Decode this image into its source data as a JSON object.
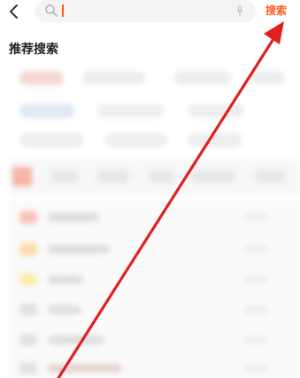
{
  "header": {
    "search_button_label": "搜索",
    "search_value": ""
  },
  "section": {
    "title": "推荐搜索"
  },
  "colors": {
    "accent": "#ff5a1f",
    "annotation_arrow": "#e02020"
  },
  "icons": {
    "back": "chevron-left-icon",
    "search": "magnifier-icon",
    "voice": "microphone-icon"
  }
}
